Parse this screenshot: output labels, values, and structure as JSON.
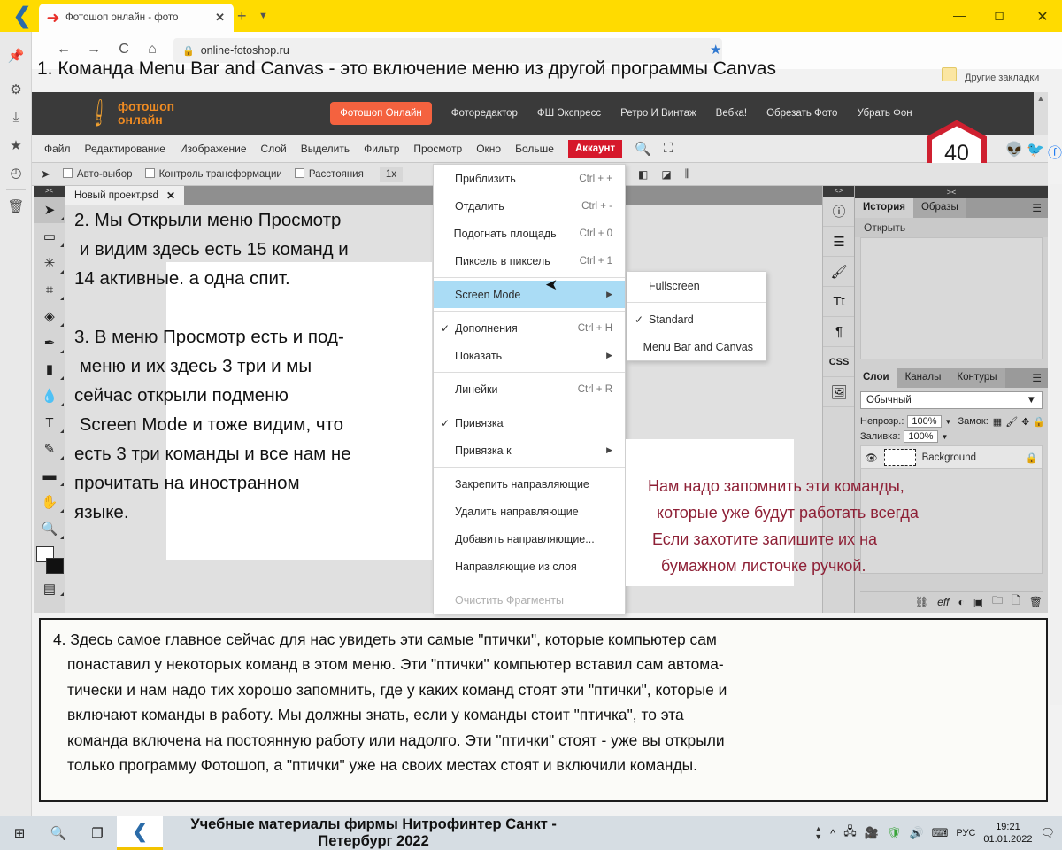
{
  "browser": {
    "tab_title": "Фотошоп онлайн - фото",
    "tab_close": "✕",
    "new_tab": "+",
    "tab_list": "▼",
    "minimize": "—",
    "maximize": "◻",
    "close": "✕",
    "back": "←",
    "forward": "→",
    "reload": "C",
    "home": "⌂",
    "url": "online-fotoshop.ru",
    "lock": "🔒",
    "bookmark_star": "★",
    "other_bookmarks": "Другие закладки",
    "rail_icons": [
      "pin-icon",
      "gear-icon",
      "download-icon",
      "star-icon",
      "history-icon",
      "trash-icon"
    ]
  },
  "annotations": {
    "line1": "1. Команда Menu Bar and Canvas - это включение меню из другой программы Canvas",
    "note2": "2. Мы Открыли меню Просмотр\n и видим здесь есть 15 команд и\n14 активные. а одна спит.",
    "note3": "3. В меню Просмотр есть и под-\n меню и их здесь 3 три и мы\nсейчас открыли подменю\n Screen Mode и тоже видим, что\nесть 3 три команды и все нам не\nпрочитать на иностранном\nязыке.",
    "note_red": "Нам надо запомнить эти команды,\n  которые уже будут работать всегда\n Если захотите запишите их на\n   бумажном листочке ручкой.",
    "red_color": "#8e2036",
    "bigbox_lines": [
      "4. Здесь самое главное сейчас для нас увидеть эти самые \"птички\", которые компьютер сам",
      "понаставил у некоторых команд в этом меню. Эти \"птички\" компьютер вставил сам автома-",
      "тически и нам надо тих хорошо запомнить, где у каких команд стоят эти \"птички\", которые и",
      "включают команды в работу. Мы должны знать, если у команды стоит \"птичка\", то эта",
      "команда включена на постоянную работу или надолго. Эти \"птички\" стоят - уже вы открыли",
      "только программу Фотошоп, а \"птички\" уже на своих местах стоят и включили команды."
    ]
  },
  "app": {
    "brand_line1": "фотошоп",
    "brand_line2": "онлайн",
    "nav_primary": "Фотошоп Онлайн",
    "nav_links": [
      "Фоторедактор",
      "ФШ Экспресс",
      "Ретро И Винтаж",
      "Вебка!",
      "Обрезать Фото",
      "Убрать Фон"
    ],
    "menus": [
      "Файл",
      "Редактирование",
      "Изображение",
      "Слой",
      "Выделить",
      "Фильтр",
      "Просмотр",
      "Окно",
      "Больше"
    ],
    "account_button": "Аккаунт",
    "search_icon": "search-icon",
    "fullscreen_icon": "fullscreen-icon",
    "badge_number": "40",
    "socials": [
      "reddit-icon",
      "twitter-icon",
      "facebook-icon"
    ],
    "options": {
      "cursor_icon": "move-tool-icon",
      "auto_select": "Авто-выбор",
      "transform_controls": "Контроль трансформации",
      "distances": "Расстояния",
      "zoom": "1x"
    },
    "document_tab": "Новый проект.psd",
    "document_tab_close": "✕"
  },
  "tools": [
    {
      "name": "move-tool",
      "glyph": "➤"
    },
    {
      "name": "marquee-tool",
      "glyph": "▭"
    },
    {
      "name": "magic-wand-tool",
      "glyph": "✳"
    },
    {
      "name": "crop-tool",
      "glyph": "⌗"
    },
    {
      "name": "eyedropper-tool",
      "glyph": "◈"
    },
    {
      "name": "brush-tool",
      "glyph": "✒"
    },
    {
      "name": "gradient-tool",
      "glyph": "▮"
    },
    {
      "name": "blur-tool",
      "glyph": "💧"
    },
    {
      "name": "type-tool",
      "glyph": "T"
    },
    {
      "name": "pen-tool",
      "glyph": "✎"
    },
    {
      "name": "shape-tool",
      "glyph": "▬"
    },
    {
      "name": "hand-tool",
      "glyph": "✋"
    },
    {
      "name": "zoom-tool",
      "glyph": "🔍"
    }
  ],
  "right_rail": [
    {
      "name": "code-icon",
      "glyph": "<>"
    },
    {
      "name": "info-icon",
      "glyph": "ⓘ"
    },
    {
      "name": "adjustments-icon",
      "glyph": "☰"
    },
    {
      "name": "brush-panel-icon",
      "glyph": "🖌"
    },
    {
      "name": "type-panel-icon",
      "glyph": "Tt"
    },
    {
      "name": "paragraph-icon",
      "glyph": "¶"
    },
    {
      "name": "css-icon",
      "glyph": "CSS"
    },
    {
      "name": "image-icon",
      "glyph": "🖼"
    }
  ],
  "panels": {
    "history": {
      "tabs": [
        "История",
        "Образы"
      ],
      "active_tab": "История",
      "items": [
        "Открыть"
      ],
      "menu_icon": "☰"
    },
    "layers": {
      "tabs": [
        "Слои",
        "Каналы",
        "Контуры"
      ],
      "active_tab": "Слои",
      "menu_icon": "☰",
      "blend_mode": "Обычный",
      "opacity_label": "Непрозр.:",
      "opacity_value": "100%",
      "lock_label": "Замок:",
      "lock_icons": [
        "transparency-lock-icon",
        "paint-lock-icon",
        "move-lock-icon",
        "all-lock-icon"
      ],
      "fill_label": "Заливка:",
      "fill_value": "100%",
      "layer_name": "Background",
      "layer_locked_icon": "lock-icon",
      "eye_icon": "eye-icon",
      "bottom_icons": [
        "link-icon",
        "fx-icon",
        "adjustment-icon",
        "mask-icon",
        "group-icon",
        "new-layer-icon",
        "delete-icon"
      ]
    }
  },
  "view_menu": {
    "items": [
      {
        "label": "Приблизить",
        "accel": "Ctrl + +",
        "checked": false,
        "arrow": false
      },
      {
        "label": "Отдалить",
        "accel": "Ctrl + -",
        "checked": false,
        "arrow": false
      },
      {
        "label": "Подогнать площадь",
        "accel": "Ctrl + 0",
        "checked": false,
        "arrow": false
      },
      {
        "label": "Пиксель в пиксель",
        "accel": "Ctrl + 1",
        "checked": false,
        "arrow": false
      },
      {
        "label": "Screen Mode",
        "accel": "",
        "checked": false,
        "arrow": true,
        "highlight": true
      },
      {
        "label": "Дополнения",
        "accel": "Ctrl + H",
        "checked": true,
        "arrow": false
      },
      {
        "label": "Показать",
        "accel": "",
        "checked": false,
        "arrow": true
      },
      {
        "label": "Линейки",
        "accel": "Ctrl + R",
        "checked": false,
        "arrow": false
      },
      {
        "label": "Привязка",
        "accel": "",
        "checked": true,
        "arrow": false
      },
      {
        "label": "Привязка к",
        "accel": "",
        "checked": false,
        "arrow": true
      },
      {
        "label": "Закрепить направляющие",
        "accel": "",
        "checked": false,
        "arrow": false
      },
      {
        "label": "Удалить направляющие",
        "accel": "",
        "checked": false,
        "arrow": false
      },
      {
        "label": "Добавить направляющие...",
        "accel": "",
        "checked": false,
        "arrow": false
      },
      {
        "label": "Направляющие из слоя",
        "accel": "",
        "checked": false,
        "arrow": false
      },
      {
        "label": "Очистить Фрагменты",
        "accel": "",
        "checked": false,
        "arrow": false,
        "disabled": true
      }
    ]
  },
  "screen_mode_submenu": {
    "items": [
      {
        "label": "Fullscreen",
        "checked": false
      },
      {
        "label": "Standard",
        "checked": true
      },
      {
        "label": "Menu Bar and Canvas",
        "checked": false
      }
    ]
  },
  "taskbar": {
    "start_icon": "windows-start-icon",
    "search_icon": "search-icon",
    "taskview_icon": "task-view-icon",
    "app_icon": "yandex-browser-icon",
    "title": "Учебные материалы фирмы Нитрофинтер  Санкт - Петербург  2022",
    "tray_icons": [
      "chevron-up-icon",
      "network-icon",
      "camera-icon",
      "shield-icon",
      "volume-icon",
      "keyboard-icon"
    ],
    "language": "РУС",
    "time": "19:21",
    "date": "01.01.2022",
    "notification_icon": "notifications-icon"
  }
}
